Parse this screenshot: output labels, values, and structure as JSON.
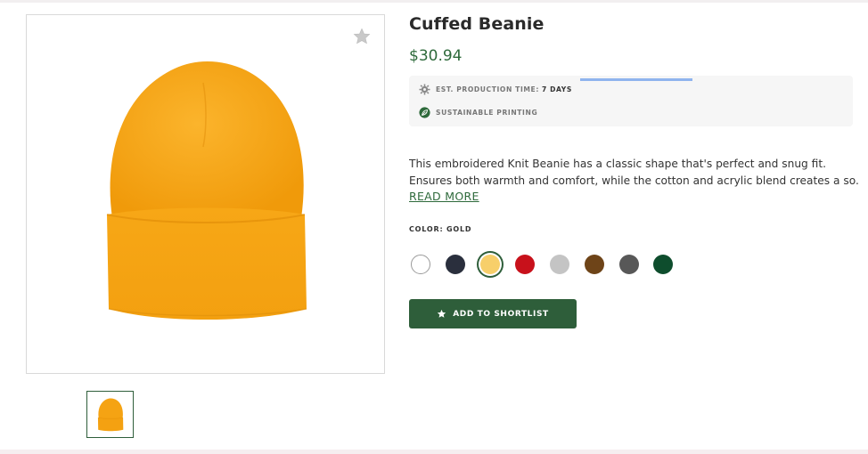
{
  "product": {
    "title": "Cuffed Beanie",
    "price": "$30.94",
    "image_alt": "gold beanie"
  },
  "info": {
    "production_label": "EST. PRODUCTION TIME:",
    "production_value": "7 DAYS",
    "production_icon": "gear-icon",
    "sustainable_label": "SUSTAINABLE PRINTING",
    "sustainable_icon": "leaf-icon"
  },
  "description": {
    "line1": "This embroidered Knit Beanie has a classic shape that's perfect and snug fit.",
    "line2": "Ensures both warmth and comfort, while the cotton and acrylic blend creates a so...",
    "read_more": "READ MORE"
  },
  "color": {
    "label": "COLOR: GOLD",
    "swatches": [
      {
        "name": "white",
        "hex": "#ffffff"
      },
      {
        "name": "navy",
        "hex": "#2a2f3d"
      },
      {
        "name": "gold",
        "hex": "#f7cf6a",
        "selected": true
      },
      {
        "name": "red",
        "hex": "#c8111b"
      },
      {
        "name": "silver",
        "hex": "#c4c4c4"
      },
      {
        "name": "brown",
        "hex": "#6e4418"
      },
      {
        "name": "charcoal",
        "hex": "#585858"
      },
      {
        "name": "forest",
        "hex": "#0e4d2d"
      }
    ]
  },
  "actions": {
    "shortlist_label": "ADD TO SHORTLIST",
    "favorite_icon": "star-icon"
  },
  "colors": {
    "accent": "#2e5e3a",
    "price": "#2e6a3b",
    "beanie": "#f7a614"
  }
}
